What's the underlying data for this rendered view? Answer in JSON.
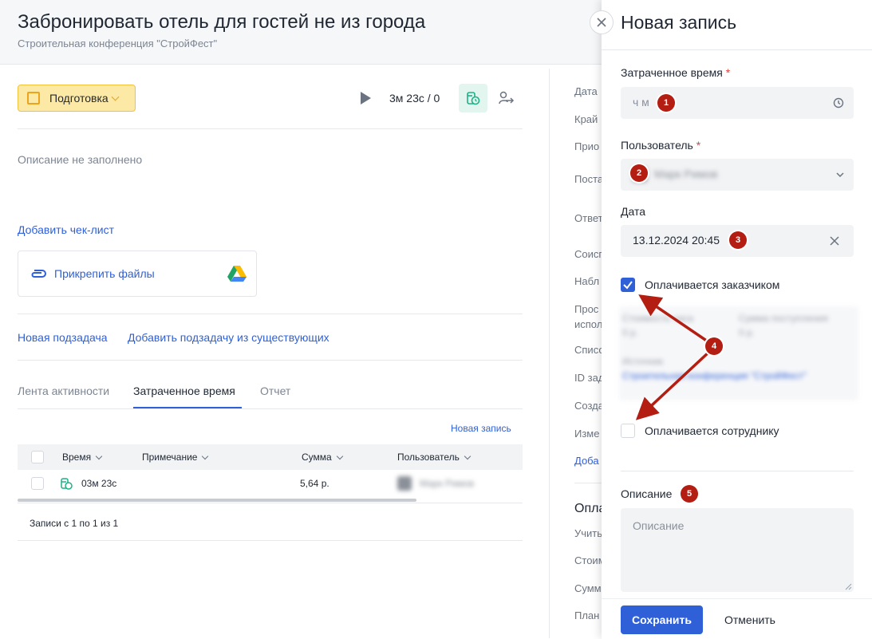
{
  "task": {
    "title": "Забронировать отель для гостей не из города",
    "subtitle": "Строительная конференция \"СтройФест\"",
    "status_label": "Подготовка",
    "timer": "3м 23с / 0",
    "description_empty": "Описание не заполнено",
    "add_checklist": "Добавить чек-лист",
    "attach_files": "Прикрепить файлы",
    "new_subtask": "Новая подзадача",
    "add_existing_subtask": "Добавить подзадачу из существующих"
  },
  "tabs": [
    {
      "label": "Лента активности"
    },
    {
      "label": "Затраченное время"
    },
    {
      "label": "Отчет"
    }
  ],
  "time_table": {
    "new_record_link": "Новая запись",
    "columns": [
      "Время",
      "Примечание",
      "Сумма",
      "Пользователь"
    ],
    "rows": [
      {
        "time": "03м 23с",
        "note": "",
        "sum": "5,64 р.",
        "user": "Марк Римов"
      }
    ],
    "footer": "Записи с 1 по 1 из 1"
  },
  "side_panel": {
    "labels": [
      "Дата",
      "Край",
      "Прио",
      "Поста",
      "Ответ",
      "Соисп",
      "Набл",
      "Прос",
      "испол",
      "Списо",
      "ID зад",
      "Созда",
      "Изме",
      "Доба",
      "Опла",
      "Учить",
      "Стоим",
      "Сумм",
      "План"
    ]
  },
  "drawer": {
    "title": "Новая запись",
    "time_label": "Затраченное время",
    "time_placeholder": "ч м",
    "user_label": "Пользователь",
    "user_value": "Марк Римов",
    "date_label": "Дата",
    "date_value": "13.12.2024 20:45",
    "paid_by_customer": "Оплачивается заказчиком",
    "paid_by_customer_checked": true,
    "blurred_fields": {
      "cost_label": "Стоимость часа",
      "cost_value": "0 р.",
      "income_label": "Сумма поступления",
      "income_value": "0 р.",
      "source_label": "Источник",
      "source_value": "Строительная конференция \"СтройФест\""
    },
    "paid_by_employee": "Оплачивается сотруднику",
    "paid_by_employee_checked": false,
    "description_label": "Описание",
    "description_placeholder": "Описание",
    "save_label": "Сохранить",
    "cancel_label": "Отменить"
  },
  "annotations": [
    "1",
    "2",
    "3",
    "4",
    "5"
  ],
  "colors": {
    "accent": "#2f60d8",
    "badge": "#b31d12",
    "status_bg": "#fde9a6",
    "status_border": "#f2c23d",
    "timer_green": "#1fb186"
  }
}
